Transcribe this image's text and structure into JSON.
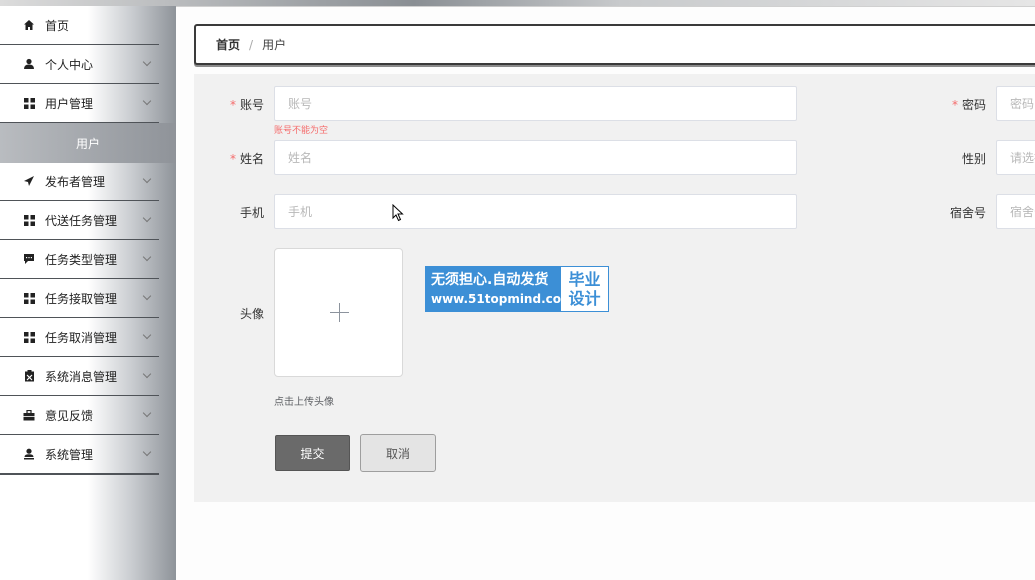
{
  "sidebar": {
    "items": [
      {
        "label": "首页",
        "icon": "home-icon"
      },
      {
        "label": "个人中心",
        "icon": "user-icon"
      },
      {
        "label": "用户管理",
        "icon": "grid-icon"
      },
      {
        "label": "发布者管理",
        "icon": "send-icon"
      },
      {
        "label": "代送任务管理",
        "icon": "grid-icon"
      },
      {
        "label": "任务类型管理",
        "icon": "message-icon"
      },
      {
        "label": "任务接取管理",
        "icon": "grid-icon"
      },
      {
        "label": "任务取消管理",
        "icon": "grid-icon"
      },
      {
        "label": "系统消息管理",
        "icon": "clipboard-icon"
      },
      {
        "label": "意见反馈",
        "icon": "briefcase-icon"
      },
      {
        "label": "系统管理",
        "icon": "admin-user-icon"
      }
    ],
    "sub_item": {
      "label": "用户"
    }
  },
  "breadcrumb": {
    "home": "首页",
    "separator": "/",
    "current": "用户"
  },
  "form": {
    "account": {
      "label": "账号",
      "placeholder": "账号",
      "error": "账号不能为空"
    },
    "password": {
      "label": "密码",
      "placeholder": "密码"
    },
    "name": {
      "label": "姓名",
      "placeholder": "姓名"
    },
    "gender": {
      "label": "性别",
      "placeholder": "请选择性别"
    },
    "phone": {
      "label": "手机",
      "placeholder": "手机"
    },
    "dorm": {
      "label": "宿舍号",
      "placeholder": "宿舍号"
    },
    "avatar": {
      "label": "头像",
      "tip": "点击上传头像"
    },
    "submit_label": "提交",
    "cancel_label": "取消"
  },
  "watermark": {
    "line1": "无须担心.自动发货",
    "line2": "www.51topmind.com",
    "right1": "毕业",
    "right2": "设计"
  },
  "colors": {
    "accent": "#3c8fd6",
    "error": "#f56c6c",
    "submit_bg": "#6a6a6a"
  }
}
